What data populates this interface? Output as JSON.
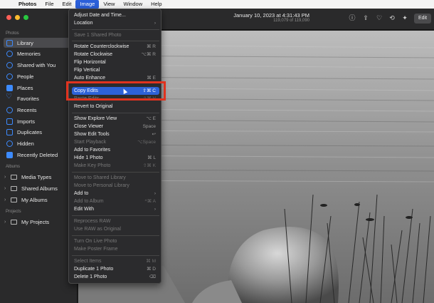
{
  "menubar": {
    "items": [
      "Photos",
      "File",
      "Edit",
      "Image",
      "View",
      "Window",
      "Help"
    ]
  },
  "window": {
    "title": "January 10, 2023 at 4:31:43 PM",
    "subtitle": "119,079 of 119,090",
    "edit_label": "Edit"
  },
  "sidebar": {
    "photos_header": "Photos",
    "items": [
      {
        "label": "Library",
        "icon": "library-icon"
      },
      {
        "label": "Memories",
        "icon": "memories-icon"
      },
      {
        "label": "Shared with You",
        "icon": "shared-with-you-icon"
      },
      {
        "label": "People",
        "icon": "people-icon"
      },
      {
        "label": "Places",
        "icon": "places-icon"
      },
      {
        "label": "Favorites",
        "icon": "favorites-icon"
      },
      {
        "label": "Recents",
        "icon": "recents-icon"
      },
      {
        "label": "Imports",
        "icon": "imports-icon"
      },
      {
        "label": "Duplicates",
        "icon": "duplicates-icon"
      },
      {
        "label": "Hidden",
        "icon": "hidden-icon"
      },
      {
        "label": "Recently Deleted",
        "icon": "trash-icon"
      }
    ],
    "albums_header": "Albums",
    "albums": [
      {
        "label": "Media Types"
      },
      {
        "label": "Shared Albums"
      },
      {
        "label": "My Albums"
      }
    ],
    "projects_header": "Projects",
    "projects": [
      {
        "label": "My Projects"
      }
    ]
  },
  "image_menu": {
    "items": [
      {
        "label": "Adjust Date and Time...",
        "shortcut": ""
      },
      {
        "label": "Location",
        "shortcut": "›"
      },
      {
        "label": "Save 1 Shared Photo",
        "shortcut": ""
      },
      {
        "label": "Rotate Counterclockwise",
        "shortcut": "⌘ R"
      },
      {
        "label": "Rotate Clockwise",
        "shortcut": "⌥⌘ R"
      },
      {
        "label": "Flip Horizontal",
        "shortcut": ""
      },
      {
        "label": "Flip Vertical",
        "shortcut": ""
      },
      {
        "label": "Auto Enhance",
        "shortcut": "⌘ E"
      },
      {
        "label": "Copy Edits",
        "shortcut": "⇧⌘ C"
      },
      {
        "label": "Paste Edits",
        "shortcut": "⇧⌘ V"
      },
      {
        "label": "Revert to Original",
        "shortcut": ""
      },
      {
        "label": "Show Explore View",
        "shortcut": "⌥ E"
      },
      {
        "label": "Close Viewer",
        "shortcut": "Space"
      },
      {
        "label": "Show Edit Tools",
        "shortcut": "↩"
      },
      {
        "label": "Start Playback",
        "shortcut": "⌥Space"
      },
      {
        "label": "Add to Favorites",
        "shortcut": ""
      },
      {
        "label": "Hide 1 Photo",
        "shortcut": "⌘ L"
      },
      {
        "label": "Make Key Photo",
        "shortcut": "⇧⌘ K"
      },
      {
        "label": "Move to Shared Library",
        "shortcut": ""
      },
      {
        "label": "Move to Personal Library",
        "shortcut": ""
      },
      {
        "label": "Add to",
        "shortcut": "›"
      },
      {
        "label": "Add to Album",
        "shortcut": "^⌘ A"
      },
      {
        "label": "Edit With",
        "shortcut": "›"
      },
      {
        "label": "Reprocess RAW",
        "shortcut": ""
      },
      {
        "label": "Use RAW as Original",
        "shortcut": ""
      },
      {
        "label": "Turn On Live Photo",
        "shortcut": ""
      },
      {
        "label": "Make Poster Frame",
        "shortcut": ""
      },
      {
        "label": "Select Items",
        "shortcut": "⌘ M"
      },
      {
        "label": "Duplicate 1 Photo",
        "shortcut": "⌘ D"
      },
      {
        "label": "Delete 1 Photo",
        "shortcut": "⌫"
      }
    ]
  }
}
